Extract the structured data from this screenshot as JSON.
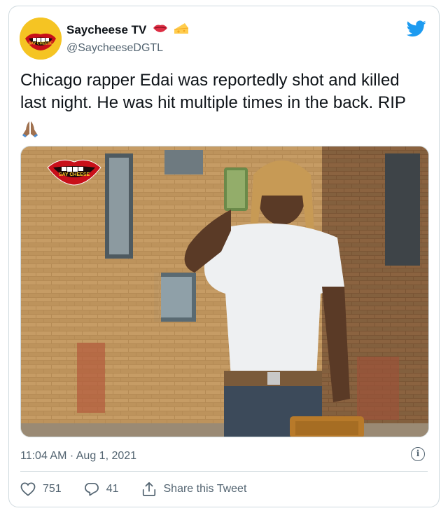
{
  "author": {
    "display_name": "Saycheese TV",
    "handle": "@SaycheeseDGTL",
    "name_emojis": [
      "lips-emoji",
      "cheese-emoji"
    ],
    "avatar_text": "SAY CHEESE"
  },
  "tweet": {
    "text": "Chicago rapper Edai was reportedly shot and killed last night. He was hit multiple times in the back. RIP",
    "trailing_emoji": "folded-hands-emoji",
    "media_logo_text": "SAY CHEESE",
    "timestamp": "11:04 AM · Aug 1, 2021",
    "info_symbol": "i"
  },
  "actions": {
    "likes": "751",
    "replies": "41",
    "share_label": "Share this Tweet"
  },
  "colors": {
    "text": "#0f1419",
    "secondary": "#536471",
    "border": "#cfd9de",
    "twitter_blue": "#1d9bf0"
  }
}
